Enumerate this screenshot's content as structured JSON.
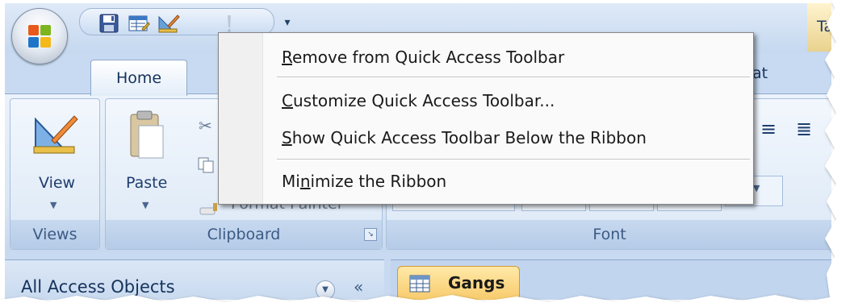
{
  "window": {
    "title_fragment": "Ta"
  },
  "quick_access_toolbar": {
    "buttons": [
      {
        "name": "save-icon"
      },
      {
        "name": "view-icon"
      },
      {
        "name": "design-icon"
      },
      {
        "name": "undo-icon"
      }
    ],
    "more_glyph": "▾"
  },
  "ribbon": {
    "tabs": [
      {
        "label": "Home"
      },
      {
        "label": "at"
      }
    ],
    "groups": {
      "views": {
        "label": "Views",
        "button_label": "View"
      },
      "clipboard": {
        "label": "Clipboard",
        "paste_label": "Paste",
        "format_painter_label": "Format Painter"
      },
      "font": {
        "label": "Font"
      }
    }
  },
  "context_menu": {
    "items": [
      {
        "label": "Remove from Quick Access Toolbar",
        "accelerator": "R"
      },
      {
        "label": "Customize Quick Access Toolbar...",
        "accelerator": "C"
      },
      {
        "label": "Show Quick Access Toolbar Below the Ribbon",
        "accelerator": "S"
      },
      {
        "label": "Minimize the Ribbon",
        "accelerator": "n"
      }
    ]
  },
  "navigation_pane": {
    "title": "All Access Objects",
    "collapse_glyph": "«"
  },
  "document_tabs": [
    {
      "label": "Gangs",
      "active": true
    }
  ],
  "colors": {
    "ribbon_bg": "#dae6f4",
    "active_doc_tab": "#f7c766",
    "menu_bg": "#fafafa"
  }
}
